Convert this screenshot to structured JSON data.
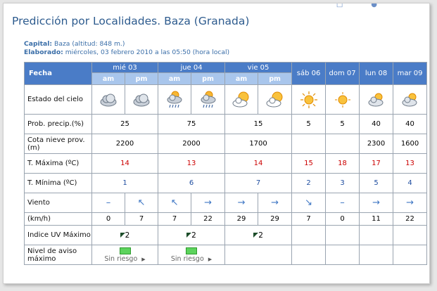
{
  "header": {
    "title": "Predicción por Localidades. Baza (Granada)",
    "capital_label": "Capital:",
    "capital_value": "Baza (altitud: 848 m.)",
    "elaborado_label": "Elaborado:",
    "elaborado_value": "miércoles, 03 febrero 2010 a las 05:50 (hora local)"
  },
  "table": {
    "fecha_label": "Fecha",
    "days": [
      "mié 03",
      "jue 04",
      "vie 05",
      "sáb 06",
      "dom 07",
      "lun 08",
      "mar 09"
    ],
    "am_label": "am",
    "pm_label": "pm",
    "labels": {
      "estado": "Estado del cielo",
      "prob": "Prob. precip.(%)",
      "cota": "Cota nieve prov.(m)",
      "tmax": "T. Máxima (ºC)",
      "tmin": "T. Mínima (ºC)",
      "viento": "Viento",
      "kmh": "(km/h)",
      "uv": "Indice UV Máximo",
      "aviso": "Nivel de aviso máximo"
    },
    "sky_icons": [
      "cloud-icon",
      "cloud-icon",
      "cloud-sun-rain-icon",
      "cloud-sun-rain-icon",
      "sun-cloud-icon",
      "sun-cloud-icon",
      "sun-icon",
      "sun-icon",
      "cloud-sun-icon",
      "cloud-sun-icon",
      "cloud-sun-icon"
    ],
    "prob": [
      "25",
      "75",
      "15",
      "5",
      "5",
      "40",
      "40"
    ],
    "cota": [
      "2200",
      "2000",
      "1700",
      "",
      "",
      "2300",
      "1600"
    ],
    "tmax": [
      "14",
      "13",
      "14",
      "15",
      "18",
      "17",
      "13"
    ],
    "tmin": [
      "1",
      "6",
      "7",
      "2",
      "3",
      "5",
      "4"
    ],
    "wind_arrows": [
      "–",
      "↖",
      "↖",
      "→",
      "→",
      "→",
      "↘",
      "–",
      "→",
      "→"
    ],
    "wind_speed": [
      "0",
      "7",
      "7",
      "22",
      "29",
      "29",
      "7",
      "0",
      "11",
      "22"
    ],
    "uv": [
      "2",
      "2",
      "2"
    ],
    "aviso": [
      "Sin riesgo",
      "Sin riesgo"
    ],
    "colors": {
      "header_blue": "#4a7cc7",
      "subheader_blue": "#a9c6ec",
      "max_red": "#cc0000",
      "min_blue": "#1f4ea0"
    }
  }
}
